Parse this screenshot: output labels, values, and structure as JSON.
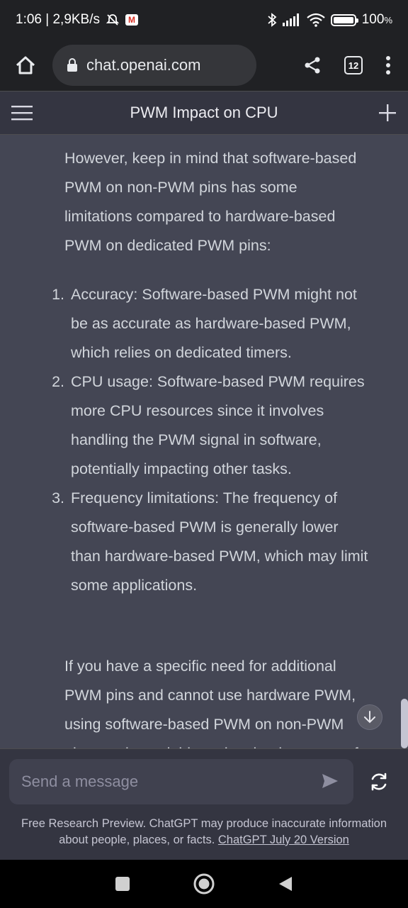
{
  "status_bar": {
    "time_speed": "1:06 | 2,9KB/s",
    "battery": "100"
  },
  "browser": {
    "url": "chat.openai.com",
    "tab_count": "12"
  },
  "app": {
    "title": "PWM Impact on CPU"
  },
  "message": {
    "intro": "However, keep in mind that software-based PWM on non-PWM pins has some limitations compared to hardware-based PWM on dedicated PWM pins:",
    "items": [
      {
        "num": "1.",
        "text": "Accuracy: Software-based PWM might not be as accurate as hardware-based PWM, which relies on dedicated timers."
      },
      {
        "num": "2.",
        "text": "CPU usage: Software-based PWM requires more CPU resources since it involves handling the PWM signal in software, potentially impacting other tasks."
      },
      {
        "num": "3.",
        "text": "Frequency limitations: The frequency of software-based PWM is generally lower than hardware-based PWM, which may limit some applications."
      }
    ],
    "outro": "If you have a specific need for additional PWM pins and cannot use hardware PWM, using software-based PWM on non-PWM pins can be a viable option, but be aware of"
  },
  "composer": {
    "placeholder": "Send a message"
  },
  "disclaimer": {
    "text": "Free Research Preview. ChatGPT may produce inaccurate information about people, places, or facts. ",
    "link": "ChatGPT July 20 Version"
  },
  "icons": {
    "status": [
      "muted-icon",
      "gmail-icon",
      "bluetooth-icon",
      "signal-icon",
      "wifi-icon",
      "battery-icon"
    ],
    "browser": [
      "home-icon",
      "lock-icon",
      "share-icon",
      "tabs-icon",
      "more-icon"
    ],
    "app": [
      "menu-icon",
      "plus-icon",
      "arrow-down-icon",
      "send-icon",
      "regenerate-icon"
    ],
    "nav": [
      "recents-icon",
      "home-circle-icon",
      "back-icon"
    ]
  },
  "colors": {
    "chat_background": "#444654",
    "header_background": "#343541",
    "input_background": "#40414f",
    "text": "#d1d5db"
  }
}
